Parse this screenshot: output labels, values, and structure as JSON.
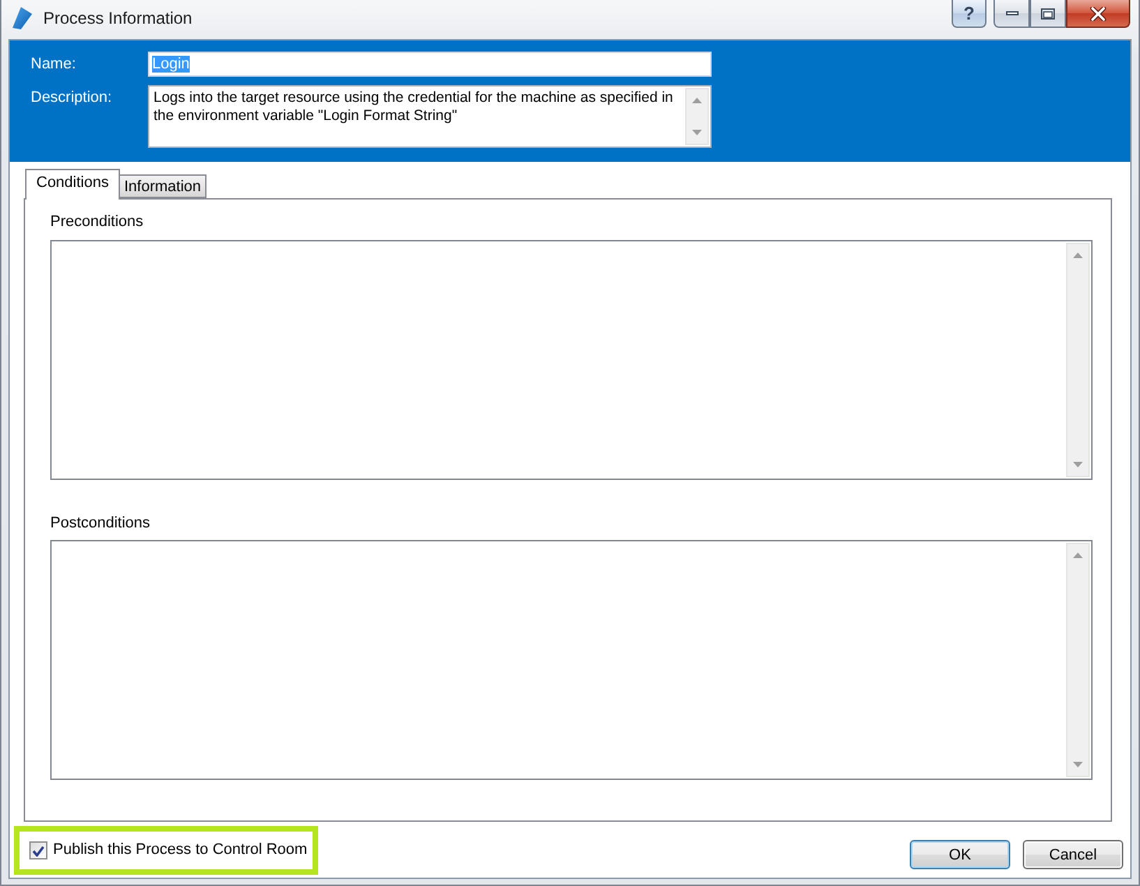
{
  "window": {
    "title": "Process Information",
    "help_button": "?"
  },
  "header": {
    "fields": [
      {
        "kind": "text",
        "label": "Name:",
        "value": "Login",
        "text_selected": true
      },
      {
        "kind": "multiline",
        "label": "Description:",
        "value": "Logs into the target resource using the credential for the machine as specified in the environment variable \"Login Format String\"",
        "text_selected": false
      }
    ]
  },
  "tabs": [
    {
      "label": "Conditions",
      "selected": true
    },
    {
      "label": "Information",
      "selected": false
    }
  ],
  "sections": [
    {
      "label": "Preconditions"
    },
    {
      "label": "Postconditions"
    }
  ],
  "publish": {
    "label": "Publish this Process to Control Room",
    "checked": true,
    "highlighted": true
  },
  "buttons": [
    {
      "label": "OK",
      "default": true
    },
    {
      "label": "Cancel",
      "default": false
    }
  ]
}
